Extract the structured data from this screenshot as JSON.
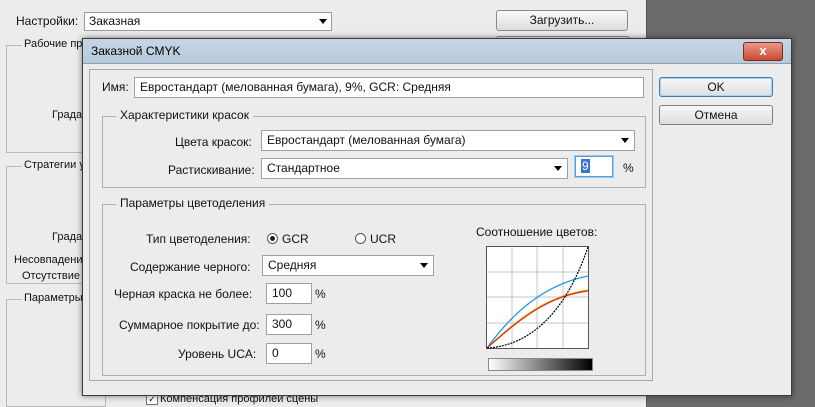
{
  "background": {
    "settings_label": "Настройки:",
    "settings_value": "Заказная",
    "load_button": "Загрузить...",
    "group1_title": "Рабочие про",
    "group2_title": "Стратегии у",
    "group3_title": "Параметры г",
    "text_grad1": "Градац",
    "text_grad2": "Градац",
    "text_mismatch": "Несовпадение",
    "text_missing": "Отсутствие",
    "checkbox_label": "Компенсация профилей сцены"
  },
  "dialog": {
    "title": "Заказной CMYK",
    "close_symbol": "x",
    "name_label": "Имя:",
    "name_value": "Евростандарт (мелованная бумага), 9%, GCR: Средняя",
    "ok_label": "OK",
    "cancel_label": "Отмена",
    "ink_group": {
      "title": "Характеристики красок",
      "ink_colors_label": "Цвета красок:",
      "ink_colors_value": "Евростандарт (мелованная бумага)",
      "dot_gain_label": "Растискивание:",
      "dot_gain_value": "Стандартное",
      "dot_gain_percent": "9",
      "percent_sign": "%"
    },
    "separation_group": {
      "title": "Параметры цветоделения",
      "type_label": "Тип цветоделения:",
      "gcr_label": "GCR",
      "ucr_label": "UCR",
      "gcr_selected": true,
      "black_gen_label": "Содержание черного:",
      "black_gen_value": "Средняя",
      "black_limit_label": "Черная краска не более:",
      "black_limit_value": "100",
      "total_ink_label": "Суммарное покрытие до:",
      "total_ink_value": "300",
      "uca_label": "Уровень UCA:",
      "uca_value": "0",
      "percent_sign": "%",
      "graph_title": "Соотношение цветов:"
    },
    "graph_colors": {
      "cyan": "#1a9ad6",
      "magenta_red": "#e02a1a",
      "yellow": "#d8b400",
      "black": "#000000"
    }
  }
}
